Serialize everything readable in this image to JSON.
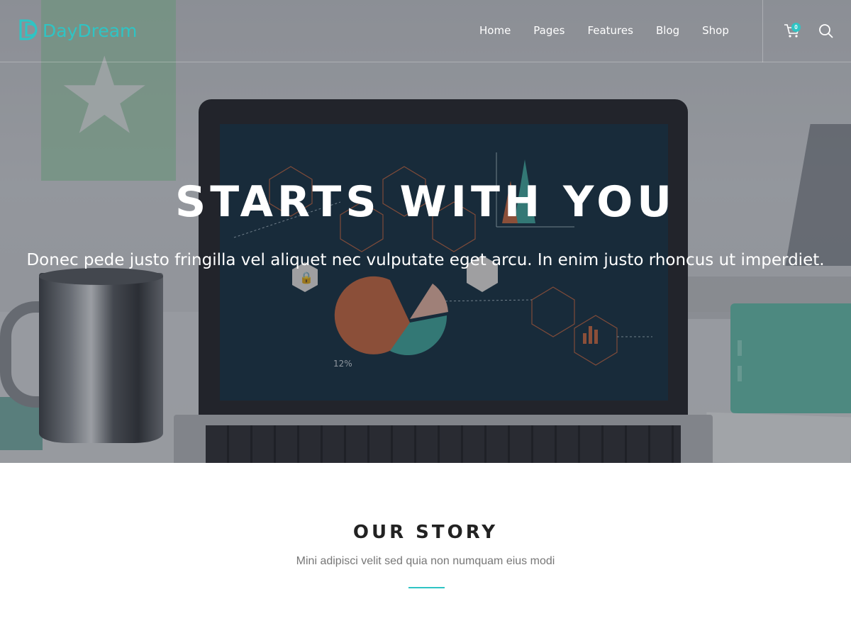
{
  "brand": {
    "name": "DayDream",
    "accent_color": "#2fc4c4"
  },
  "nav": {
    "items": [
      {
        "label": "Home"
      },
      {
        "label": "Pages"
      },
      {
        "label": "Features"
      },
      {
        "label": "Blog"
      },
      {
        "label": "Shop"
      }
    ],
    "cart_count": "0",
    "icons": [
      "cart-icon",
      "search-icon"
    ]
  },
  "hero": {
    "title": "STARTS WITH YOU",
    "subtitle": "Donec pede justo fringilla vel aliquet nec vulputate eget arcu. In enim justo rhoncus ut imperdiet.",
    "screen_label": "12%"
  },
  "story": {
    "title": "OUR STORY",
    "subtitle": "Mini adipisci velit sed quia non numquam eius modi"
  }
}
